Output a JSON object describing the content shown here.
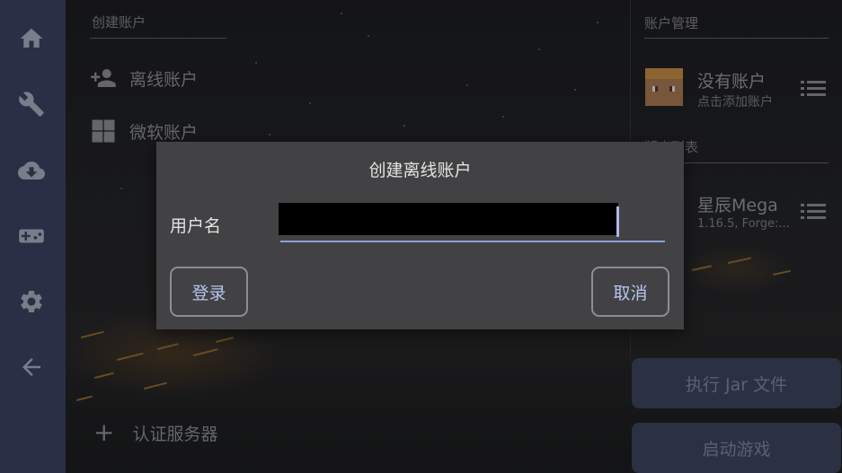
{
  "nav": {
    "items": [
      {
        "icon": "home-icon"
      },
      {
        "icon": "wrench-icon"
      },
      {
        "icon": "cloud-download-icon"
      },
      {
        "icon": "gamepad-icon"
      },
      {
        "icon": "gear-icon"
      },
      {
        "icon": "back-arrow-icon"
      }
    ]
  },
  "left": {
    "section_title": "创建账户",
    "offline_account": "离线账户",
    "microsoft_account": "微软账户",
    "auth_server": "认证服务器"
  },
  "right": {
    "account_section_title": "账户管理",
    "account": {
      "name": "没有账户",
      "subtitle": "点击添加账户"
    },
    "version_section_title": "版本列表",
    "game": {
      "name": "星辰Mega",
      "subtitle": "1.16.5, Forge:..."
    },
    "run_jar_button": "执行 Jar 文件",
    "launch_button": "启动游戏"
  },
  "dialog": {
    "title": "创建离线账户",
    "username_label": "用户名",
    "username_value": "",
    "login_button": "登录",
    "cancel_button": "取消"
  },
  "colors": {
    "rail": "#40496a",
    "dialog": "#424244",
    "accent": "#b6c4f0",
    "underline": "#8fa0d6",
    "button_bg": "#434b66"
  }
}
